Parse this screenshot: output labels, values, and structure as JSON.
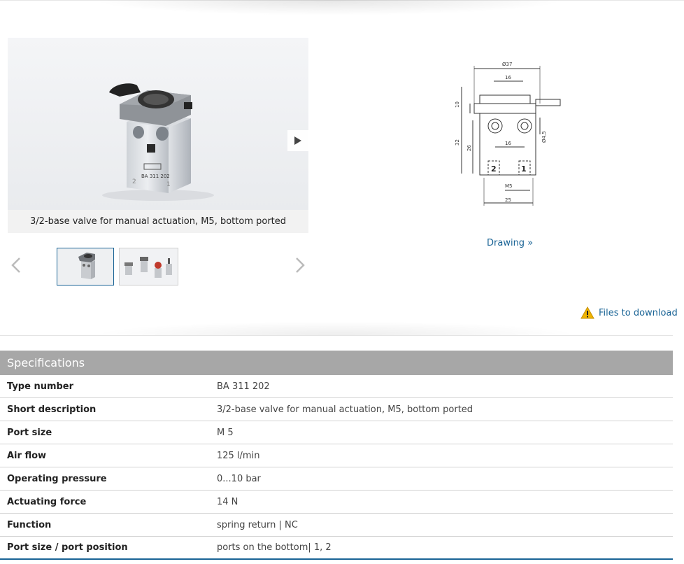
{
  "gallery": {
    "caption": "3/2-base valve for manual actuation, M5, bottom ported",
    "body_label": "BA 311 202",
    "port_left": "2",
    "port_right": "1"
  },
  "drawing": {
    "link_label": "Drawing »",
    "dims": {
      "top_width": "Ø37",
      "inner_top": "16",
      "height_left": "10",
      "height_total": "32",
      "height_mid": "26",
      "inner_mid": "16",
      "hole": "Ø4,5",
      "port_label": "M5",
      "bottom_width": "25",
      "port_left": "2",
      "port_right": "1"
    }
  },
  "downloads": {
    "label": "Files to download",
    "warning_color": "#f0b400"
  },
  "specifications": {
    "title": "Specifications",
    "rows": [
      {
        "key": "Type number",
        "value": "BA 311 202"
      },
      {
        "key": "Short description",
        "value": "3/2-base valve for manual actuation, M5, bottom ported"
      },
      {
        "key": "Port size",
        "value": "M 5"
      },
      {
        "key": "Air flow",
        "value": "125 l/min"
      },
      {
        "key": "Operating pressure",
        "value": "0...10 bar"
      },
      {
        "key": "Actuating force",
        "value": "14 N"
      },
      {
        "key": "Function",
        "value": "spring return | NC"
      },
      {
        "key": "Port size / port position",
        "value": "ports on the bottom| 1, 2"
      }
    ]
  },
  "colors": {
    "link": "#1a6496",
    "header_bg": "#a7a7a7",
    "active_thumb_border": "#1a6496"
  }
}
